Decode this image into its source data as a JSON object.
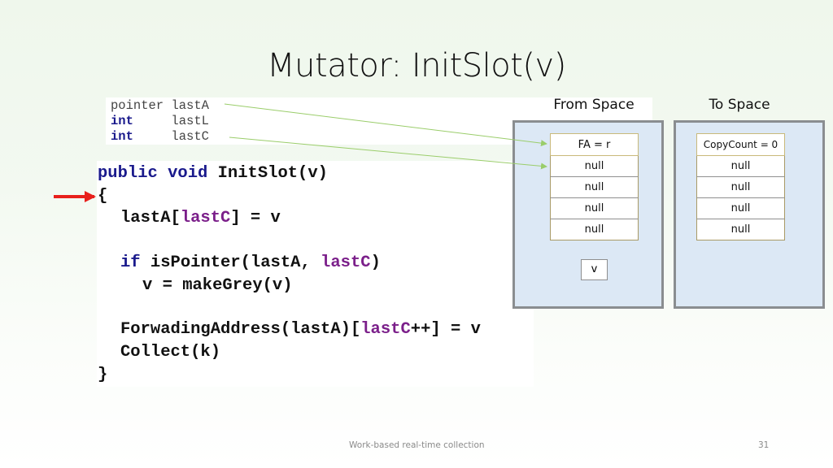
{
  "slide": {
    "title": "Mutator: InitSlot(v)",
    "footer": "Work-based real-time collection",
    "page_number": "31"
  },
  "declarations": [
    {
      "type": "pointer",
      "name": "lastA"
    },
    {
      "type": "int",
      "name": "lastL"
    },
    {
      "type": "int",
      "name": "lastC"
    }
  ],
  "code": {
    "line1": {
      "kw": "public void",
      "rest": " InitSlot(v)"
    },
    "line2": "{",
    "line3": {
      "a": "lastA[",
      "var": "lastC",
      "b": "] = v"
    },
    "line4": {
      "kw": "if",
      "a": " isPointer(lastA, ",
      "var": "lastC",
      "b": ")"
    },
    "line5": "v = makeGrey(v)",
    "line6": {
      "a": "ForwadingAddress(lastA)[",
      "var": "lastC",
      "b": "++] = v"
    },
    "line7": "Collect(k)",
    "line8": "}"
  },
  "from_space": {
    "label": "From Space",
    "cells": [
      "FA = r",
      "null",
      "null",
      "null",
      "null"
    ],
    "value_box": "v"
  },
  "to_space": {
    "label": "To Space",
    "cells": [
      "CopyCount = 0",
      "null",
      "null",
      "null",
      "null"
    ]
  },
  "colors": {
    "keyword": "#1a1a8c",
    "variable": "#7b1f8a",
    "arrow_current_line": "#e8201c",
    "pointer_arrow": "#9acd6a",
    "space_fill": "#dce8f5"
  }
}
